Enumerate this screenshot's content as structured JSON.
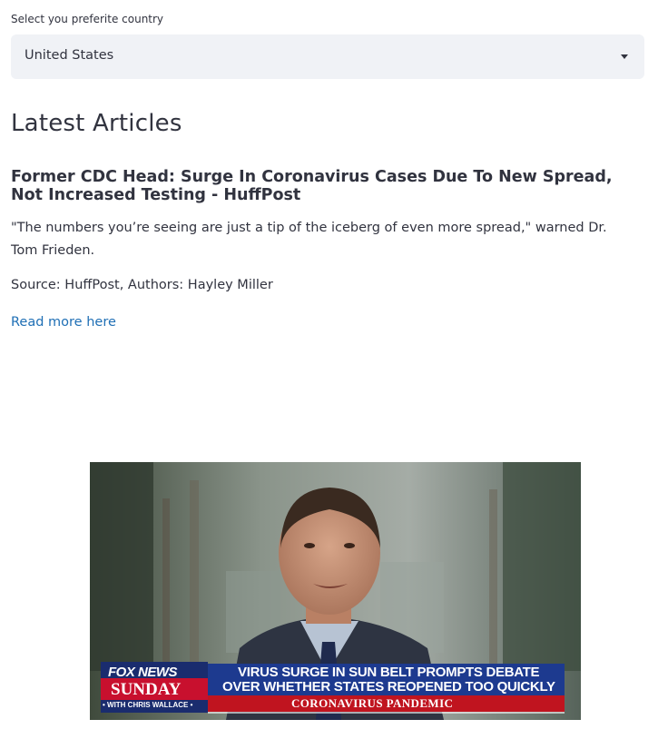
{
  "country_select": {
    "label": "Select you preferite country",
    "selected_value": "United States"
  },
  "section": {
    "title": "Latest Articles"
  },
  "article": {
    "title": "Former CDC Head: Surge In Coronavirus Cases Due To New Spread, Not Increased Testing - HuffPost",
    "description": "\"The numbers you’re seeing are just a tip of the iceberg of even more spread,\" warned Dr. Tom Frieden.",
    "source_line": "Source: HuffPost, Authors: Hayley Miller",
    "read_more_label": "Read more here",
    "image": {
      "chyron": {
        "network": "FOX NEWS",
        "show": "SUNDAY",
        "host": "• WITH CHRIS WALLACE •",
        "headline_line1": "VIRUS SURGE IN SUN BELT PROMPTS DEBATE",
        "headline_line2": "OVER WHETHER STATES REOPENED TOO QUICKLY",
        "banner": "CORONAVIRUS PANDEMIC"
      }
    }
  },
  "colors": {
    "link": "#1f6fb5",
    "select_background": "#f0f2f6",
    "text": "#31333f"
  }
}
